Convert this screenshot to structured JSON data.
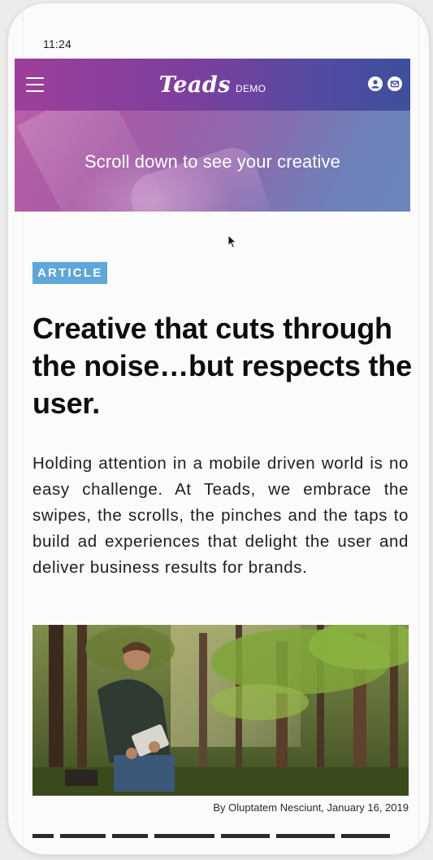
{
  "status_bar": {
    "time": "11:24"
  },
  "navbar": {
    "brand": "Teads",
    "brand_sub": "DEMO",
    "menu_icon": "hamburger-menu-icon",
    "account_icon": "user-circle-icon",
    "mail_icon": "mail-circle-icon"
  },
  "hero": {
    "text": "Scroll down to see your creative"
  },
  "article": {
    "badge": "ARTICLE",
    "headline": "Creative that cuts through the noise…but respects the user.",
    "body": "Holding attention in a mobile driven world is no easy challenge. At Teads, we embrace the swipes, the scrolls, the pinches and the taps to build ad experiences that delight the user and deliver business results for brands.",
    "caption": "By Oluptatem Nesciunt, January 16, 2019"
  },
  "colors": {
    "nav_start": "#9d3f9a",
    "nav_end": "#3e4f9c",
    "badge": "#5fa6d9"
  }
}
